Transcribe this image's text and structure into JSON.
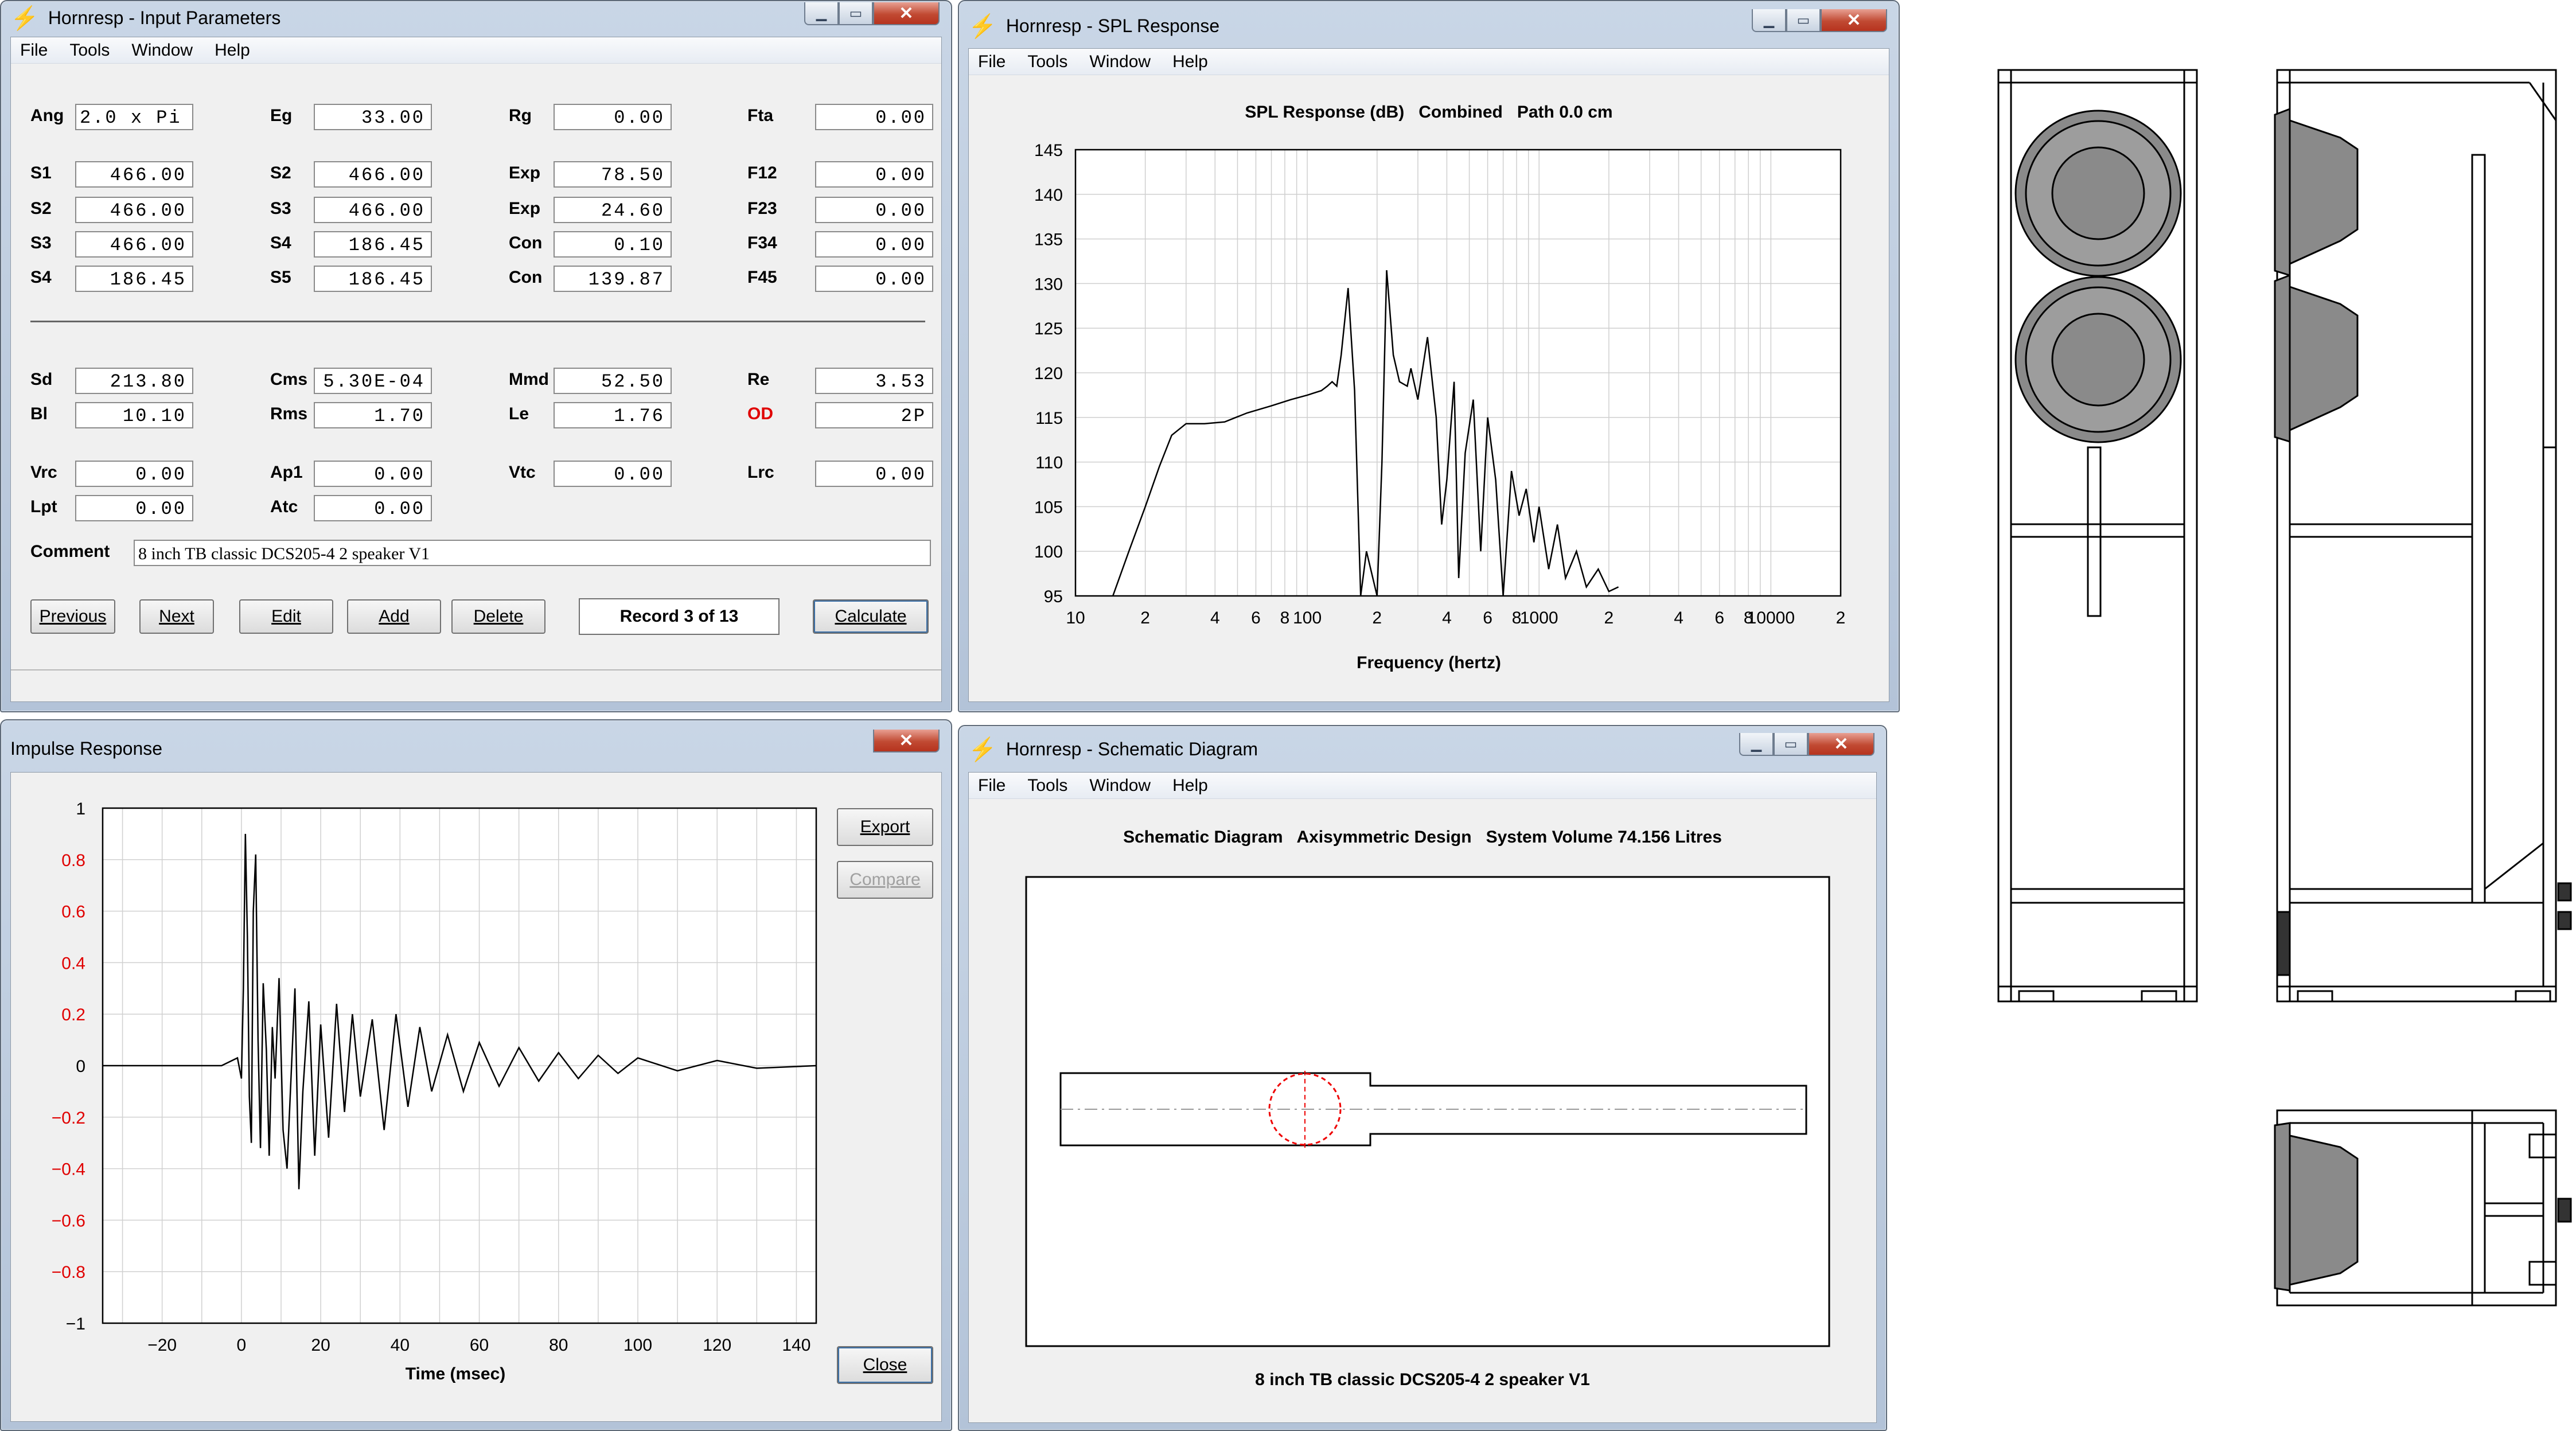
{
  "input_params": {
    "title": "Hornresp - Input Parameters",
    "menu": [
      "File",
      "Tools",
      "Window",
      "Help"
    ],
    "params": [
      {
        "label": "Ang",
        "value": "2.0 x Pi"
      },
      {
        "label": "Eg",
        "value": "33.00"
      },
      {
        "label": "Rg",
        "value": "0.00"
      },
      {
        "label": "Fta",
        "value": "0.00"
      },
      {
        "label": "S1",
        "value": "466.00"
      },
      {
        "label": "S2",
        "value": "466.00"
      },
      {
        "label": "Exp",
        "value": "78.50"
      },
      {
        "label": "F12",
        "value": "0.00"
      },
      {
        "label": "S2",
        "value": "466.00"
      },
      {
        "label": "S3",
        "value": "466.00"
      },
      {
        "label": "Exp",
        "value": "24.60"
      },
      {
        "label": "F23",
        "value": "0.00"
      },
      {
        "label": "S3",
        "value": "466.00"
      },
      {
        "label": "S4",
        "value": "186.45"
      },
      {
        "label": "Con",
        "value": "0.10"
      },
      {
        "label": "F34",
        "value": "0.00"
      },
      {
        "label": "S4",
        "value": "186.45"
      },
      {
        "label": "S5",
        "value": "186.45"
      },
      {
        "label": "Con",
        "value": "139.87"
      },
      {
        "label": "F45",
        "value": "0.00"
      },
      {
        "label": "Sd",
        "value": "213.80"
      },
      {
        "label": "Cms",
        "value": "5.30E-04"
      },
      {
        "label": "Mmd",
        "value": "52.50"
      },
      {
        "label": "Re",
        "value": "3.53"
      },
      {
        "label": "Bl",
        "value": "10.10"
      },
      {
        "label": "Rms",
        "value": "1.70"
      },
      {
        "label": "Le",
        "value": "1.76"
      },
      {
        "label": "OD",
        "value": "2P"
      },
      {
        "label": "Vrc",
        "value": "0.00"
      },
      {
        "label": "Ap1",
        "value": "0.00"
      },
      {
        "label": "Vtc",
        "value": "0.00"
      },
      {
        "label": "Lrc",
        "value": "0.00"
      },
      {
        "label": "Lpt",
        "value": "0.00"
      },
      {
        "label": "Atc",
        "value": "0.00"
      }
    ],
    "od_color": "#e00000",
    "comment_label": "Comment",
    "comment_value": "8 inch TB classic DCS205-4 2 speaker V1",
    "buttons": {
      "previous": "Previous",
      "next": "Next",
      "edit": "Edit",
      "add": "Add",
      "delete": "Delete",
      "calculate": "Calculate"
    },
    "record": "Record 3 of 13"
  },
  "spl": {
    "title": "Hornresp - SPL Response",
    "menu": [
      "File",
      "Tools",
      "Window",
      "Help"
    ],
    "chart_title": "SPL Response (dB)   Combined   Path 0.0 cm",
    "xlabel": "Frequency (hertz)",
    "xticks": [
      "10",
      "2",
      "4",
      "6",
      "8",
      "100",
      "2",
      "4",
      "6",
      "8",
      "1000",
      "2",
      "4",
      "6",
      "8",
      "10000",
      "2"
    ],
    "yticks": [
      "145",
      "140",
      "135",
      "130",
      "125",
      "120",
      "115",
      "110",
      "105",
      "100",
      "95"
    ]
  },
  "impulse": {
    "title": "Impulse Response",
    "xlabel": "Time (msec)",
    "xticks": [
      "−20",
      "0",
      "20",
      "40",
      "60",
      "80",
      "100",
      "120",
      "140"
    ],
    "yticks": [
      "1",
      "0.8",
      "0.6",
      "0.4",
      "0.2",
      "0",
      "−0.2",
      "−0.4",
      "−0.6",
      "−0.8",
      "−1"
    ],
    "tick_red": "#e00000",
    "buttons": {
      "export": "Export",
      "compare": "Compare",
      "close": "Close"
    }
  },
  "schematic": {
    "title": "Hornresp - Schematic Diagram",
    "menu": [
      "File",
      "Tools",
      "Window",
      "Help"
    ],
    "header": "Schematic Diagram   Axisymmetric Design   System Volume 74.156 Litres",
    "footer": "8 inch TB classic DCS205-4 2 speaker V1"
  },
  "chart_data": [
    {
      "type": "line",
      "title": "SPL Response (dB)   Combined   Path 0.0 cm",
      "xlabel": "Frequency (hertz)",
      "ylabel": "",
      "xscale": "log",
      "xlim": [
        10,
        20000
      ],
      "ylim": [
        95,
        145
      ],
      "grid": true,
      "x": [
        14.5,
        17,
        20,
        23,
        26,
        30,
        36,
        44,
        55,
        70,
        85,
        100,
        115,
        122,
        128,
        134,
        140,
        150,
        160,
        170,
        180,
        200,
        210,
        220,
        235,
        250,
        270,
        280,
        300,
        330,
        360,
        380,
        400,
        430,
        450,
        480,
        520,
        560,
        600,
        650,
        700,
        760,
        820,
        880,
        950,
        1000,
        1100,
        1200,
        1300,
        1450,
        1600,
        1800,
        2000,
        2200
      ],
      "y": [
        95,
        100,
        105,
        109.5,
        113,
        114.3,
        114.3,
        114.5,
        115.5,
        116.3,
        117,
        117.5,
        118,
        118.5,
        119,
        118.5,
        122,
        129.5,
        118,
        95,
        100,
        95,
        110,
        131.5,
        122,
        119,
        118.5,
        120.5,
        117,
        124,
        115,
        103,
        108,
        119,
        97,
        111,
        117,
        100,
        115,
        108,
        95,
        109,
        104,
        107,
        101,
        105,
        98,
        103,
        97,
        100,
        96,
        98,
        95.5,
        96
      ]
    },
    {
      "type": "line",
      "title": "",
      "xlabel": "Time (msec)",
      "ylabel": "",
      "xlim": [
        -35,
        145
      ],
      "ylim": [
        -1,
        1
      ],
      "grid": true,
      "x": [
        -35,
        -5,
        -1,
        0,
        0.5,
        1,
        1.5,
        2,
        2.5,
        3,
        3.6,
        4.2,
        4.8,
        5.5,
        6.3,
        7,
        7.8,
        8.5,
        9.5,
        10.5,
        11.5,
        12.5,
        13.5,
        14.5,
        15.5,
        17,
        18.5,
        20,
        22,
        24,
        26,
        28,
        30,
        33,
        36,
        39,
        42,
        45,
        48,
        52,
        56,
        60,
        65,
        70,
        75,
        80,
        85,
        90,
        95,
        100,
        110,
        120,
        130,
        145
      ],
      "y": [
        0,
        0,
        0.03,
        -0.05,
        0.3,
        0.9,
        0.5,
        -0.12,
        -0.3,
        0.6,
        0.82,
        0.1,
        -0.32,
        0.32,
        0.06,
        -0.35,
        0.15,
        -0.05,
        0.34,
        -0.25,
        -0.4,
        -0.05,
        0.3,
        -0.48,
        -0.1,
        0.25,
        -0.35,
        0.16,
        -0.28,
        0.24,
        -0.18,
        0.2,
        -0.12,
        0.18,
        -0.25,
        0.2,
        -0.16,
        0.15,
        -0.1,
        0.12,
        -0.1,
        0.09,
        -0.08,
        0.07,
        -0.06,
        0.05,
        -0.05,
        0.04,
        -0.03,
        0.03,
        -0.02,
        0.02,
        -0.01,
        0
      ]
    }
  ]
}
